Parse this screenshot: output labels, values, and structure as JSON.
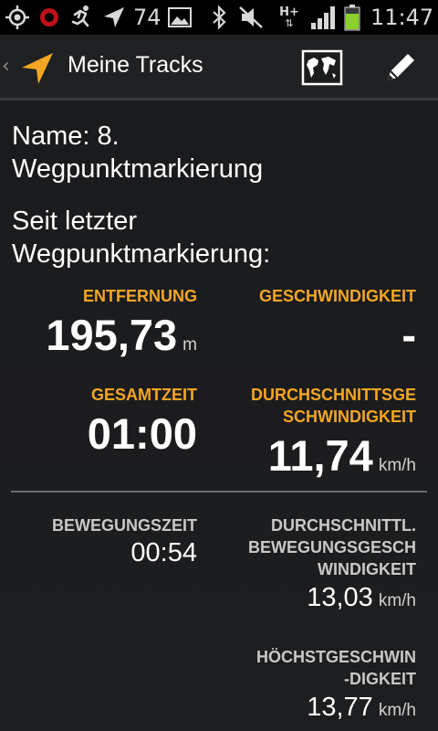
{
  "status_bar": {
    "icons_left": [
      "gps-icon",
      "record-icon",
      "runner-icon",
      "navigation-icon"
    ],
    "battery_level": "74",
    "icons_right": [
      "image-icon",
      "bluetooth-icon",
      "mute-icon",
      "data-hplus-icon",
      "signal-icon",
      "battery-icon"
    ],
    "network": "H+",
    "time": "11:47"
  },
  "action_bar": {
    "back_glyph": "‹",
    "title": "Meine Tracks",
    "map_button": "map-icon",
    "edit_button": "pencil-icon"
  },
  "content": {
    "name_line1": "Name: 8.",
    "name_line2": "Wegpunktmarkierung",
    "since_line1": "Seit letzter",
    "since_line2": "Wegpunktmarkierung:",
    "stats_primary": {
      "distance_label": "ENTFERNUNG",
      "distance_value": "195,73",
      "distance_unit": "m",
      "speed_label": "GESCHWINDIGKEIT",
      "speed_value": "-",
      "total_time_label": "GESAMTZEIT",
      "total_time_value": "01:00",
      "avg_speed_label_1": "DURCHSCHNITTSGE",
      "avg_speed_label_2": "SCHWINDIGKEIT",
      "avg_speed_value": "11,74",
      "avg_speed_unit": "km/h"
    },
    "stats_secondary": {
      "moving_time_label": "BEWEGUNGSZEIT",
      "moving_time_value": "00:54",
      "avg_moving_speed_label_1": "DURCHSCHNITTL.",
      "avg_moving_speed_label_2": "BEWEGUNGSGESCH",
      "avg_moving_speed_label_3": "WINDIGKEIT",
      "avg_moving_speed_value": "13,03",
      "avg_moving_speed_unit": "km/h",
      "max_speed_label_1": "HÖCHSTGESCHWIN",
      "max_speed_label_2": "-DIGKEIT",
      "max_speed_value": "13,77",
      "max_speed_unit": "km/h"
    }
  },
  "colors": {
    "accent": "#f5a623",
    "background": "#1b1c1e",
    "secondary_label": "#c8c8c8"
  }
}
